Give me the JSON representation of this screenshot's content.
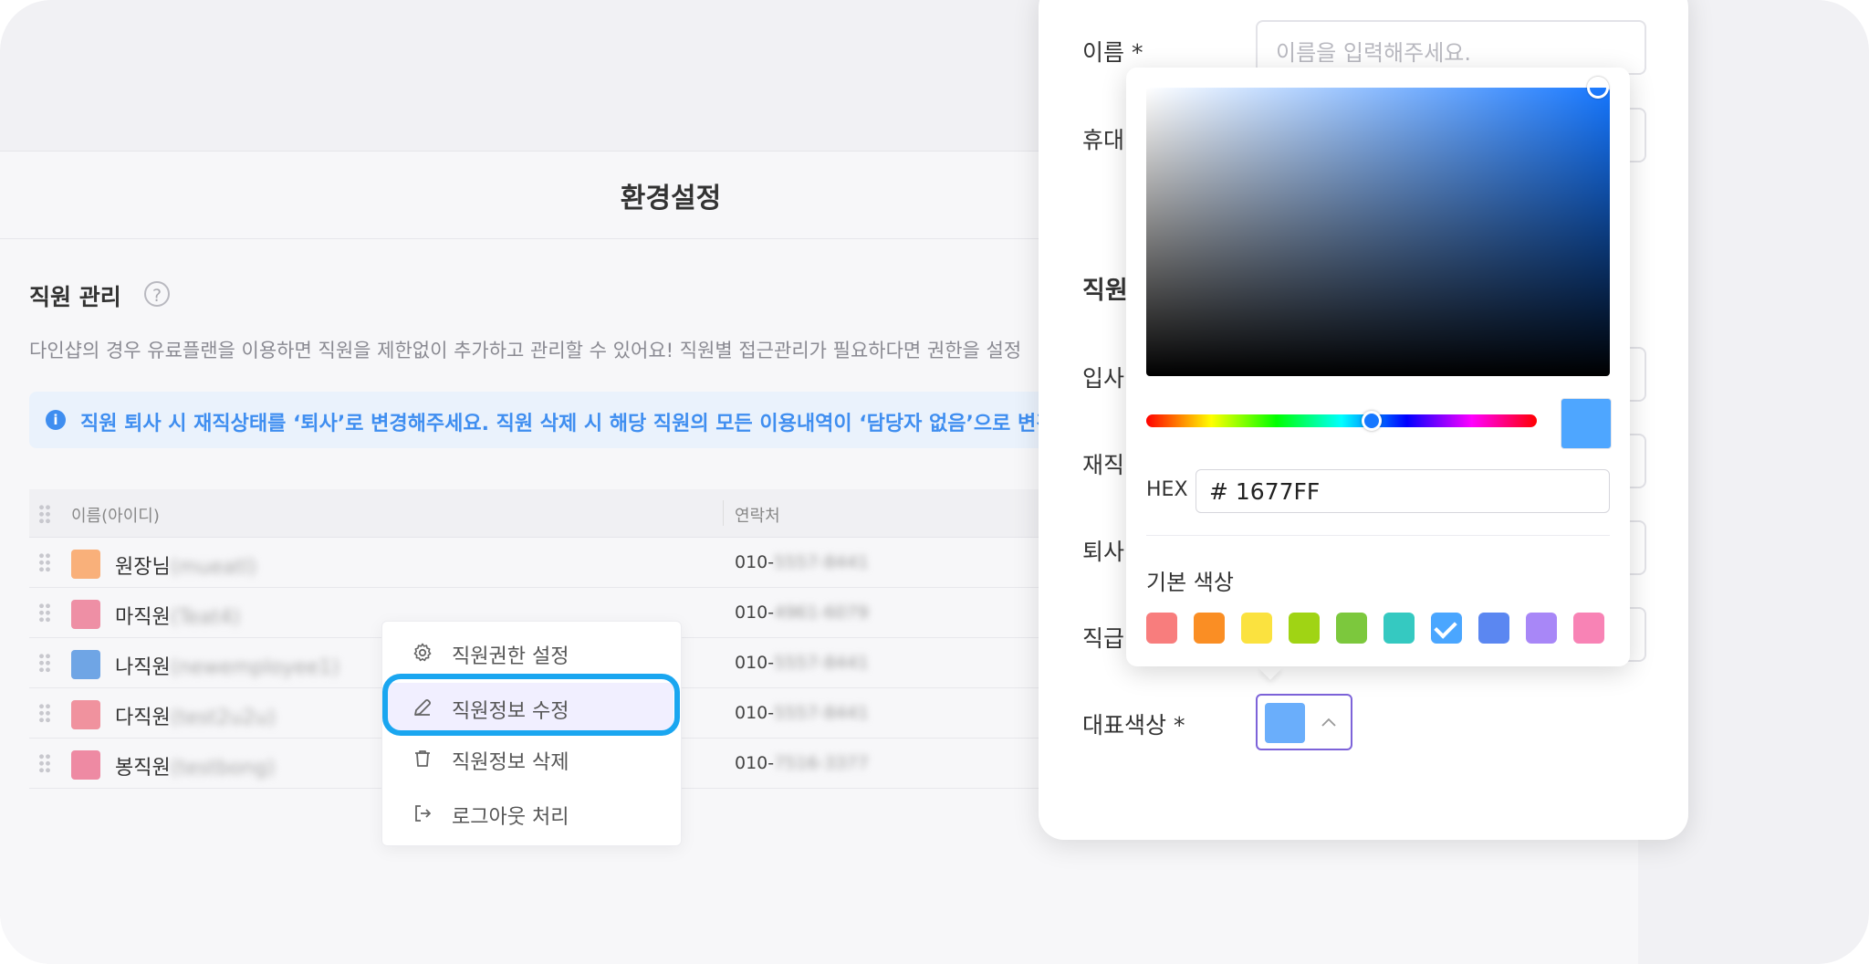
{
  "settings": {
    "title": "환경설정",
    "section_title": "직원 관리",
    "help_symbol": "?",
    "description": "다인샵의 경우 유료플랜을 이용하면 직원을 제한없이 추가하고 관리할 수 있어요! 직원별 접근관리가 필요하다면 권한을 설정",
    "notice": "직원 퇴사 시 재직상태를 ‘퇴사’로 변경해주세요. 직원 삭제 시 해당 직원의 모든 이용내역이 ‘담당자 없음’으로 변경",
    "notice_icon": "i"
  },
  "table": {
    "headers": {
      "name": "이름(아이디)",
      "phone": "연락처"
    },
    "rows": [
      {
        "name": "원장님",
        "id": "(mueatl)",
        "phone_prefix": "010-",
        "phone_rest": "5557-8441",
        "color": "#f9b07a"
      },
      {
        "name": "마직원",
        "id": "(Teat4)",
        "phone_prefix": "010-",
        "phone_rest": "4961-6079",
        "color": "#ee8fa5"
      },
      {
        "name": "나직원",
        "id": "(newemployee1)",
        "phone_prefix": "010-",
        "phone_rest": "5557-8441",
        "color": "#6fa5e5"
      },
      {
        "name": "다직원",
        "id": "(test2u2u)",
        "phone_prefix": "010-",
        "phone_rest": "5557-8441",
        "color": "#f0929e"
      },
      {
        "name": "봉직원",
        "id": "(testbong)",
        "phone_prefix": "010-",
        "phone_rest": "7516-3377",
        "color": "#ee8aa3"
      }
    ]
  },
  "context_menu": {
    "items": [
      {
        "label": "직원권한 설정",
        "icon": "gear-icon"
      },
      {
        "label": "직원정보 수정",
        "icon": "pencil-icon"
      },
      {
        "label": "직원정보 삭제",
        "icon": "trash-icon"
      },
      {
        "label": "로그아웃 처리",
        "icon": "logout-icon"
      }
    ],
    "active_index": 1
  },
  "form": {
    "name_label": "이름 *",
    "name_placeholder": "이름을 입력해주세요.",
    "phone_label": "휴대",
    "section_label": "직원",
    "join_label": "입사",
    "status_label": "재직",
    "leave_label": "퇴사",
    "rank_label": "직급",
    "color_label": "대표색상 *",
    "selected_color": "#6aaefb"
  },
  "color_picker": {
    "hex_label": "HEX",
    "hex_value": "# 1677FF",
    "basic_title": "기본 색상",
    "presets": [
      "#f87d7d",
      "#fa8e24",
      "#fbe23f",
      "#a0d414",
      "#7cc83d",
      "#35c9c1",
      "#4aa6ff",
      "#5b87f1",
      "#a887f7",
      "#f883b5"
    ],
    "selected_preset_index": 6,
    "preview_color": "#4ea6ff",
    "base_hue": "#1677ff"
  }
}
